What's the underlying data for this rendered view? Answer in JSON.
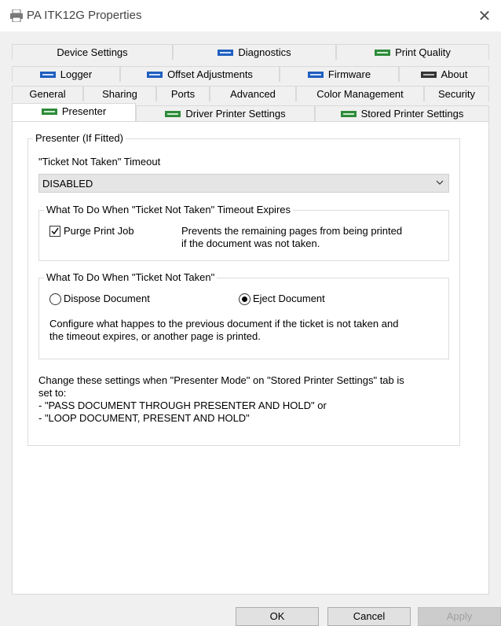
{
  "window": {
    "title": "PA ITK12G Properties",
    "close_glyph": "✕",
    "icon": "printer-icon"
  },
  "tabs": {
    "row1": [
      {
        "label": "Device Settings",
        "icon": null
      },
      {
        "label": "Diagnostics",
        "icon": "blue-printer-icon"
      },
      {
        "label": "Print Quality",
        "icon": "green-printer-icon"
      }
    ],
    "row2": [
      {
        "label": "Logger",
        "icon": "blue-printer-icon"
      },
      {
        "label": "Offset Adjustments",
        "icon": "blue-printer-icon"
      },
      {
        "label": "Firmware",
        "icon": "blue-printer-icon"
      },
      {
        "label": "About",
        "icon": "dark-printer-icon"
      }
    ],
    "row3": [
      {
        "label": "General"
      },
      {
        "label": "Sharing"
      },
      {
        "label": "Ports"
      },
      {
        "label": "Advanced"
      },
      {
        "label": "Color Management"
      },
      {
        "label": "Security"
      }
    ],
    "row4": [
      {
        "label": "Presenter",
        "icon": "green-printer-icon",
        "active": true
      },
      {
        "label": "Driver Printer Settings",
        "icon": "green-printer-icon"
      },
      {
        "label": "Stored Printer Settings",
        "icon": "green-printer-icon"
      }
    ]
  },
  "presenter": {
    "group_title": "Presenter (If Fitted)",
    "timeout_label": "\"Ticket Not Taken\" Timeout",
    "timeout_value": "DISABLED",
    "expires_group": {
      "title": "What To Do When \"Ticket Not Taken\" Timeout Expires",
      "purge_label": "Purge Print Job",
      "purge_checked": true,
      "purge_desc_line1": "Prevents the remaining pages from being printed",
      "purge_desc_line2": "if the document was not taken."
    },
    "not_taken_group": {
      "title": "What To Do When \"Ticket Not Taken\"",
      "option_dispose": "Dispose Document",
      "option_eject": "Eject Document",
      "selected": "Eject Document",
      "desc_line1": "Configure what happes to the previous document if the ticket is not taken and",
      "desc_line2": "the timeout expires, or another page is printed."
    },
    "note_line1": "Change these settings when \"Presenter Mode\" on \"Stored Printer Settings\" tab is",
    "note_line2": "set to:",
    "note_line3": "- \"PASS DOCUMENT THROUGH PRESENTER AND HOLD\" or",
    "note_line4": "- \"LOOP DOCUMENT, PRESENT AND HOLD\""
  },
  "buttons": {
    "ok": "OK",
    "cancel": "Cancel",
    "apply": "Apply",
    "apply_disabled": true
  },
  "colors": {
    "blue_icon": "#1f5fbf",
    "green_icon": "#2e8b3a",
    "dark_icon": "#333333"
  }
}
